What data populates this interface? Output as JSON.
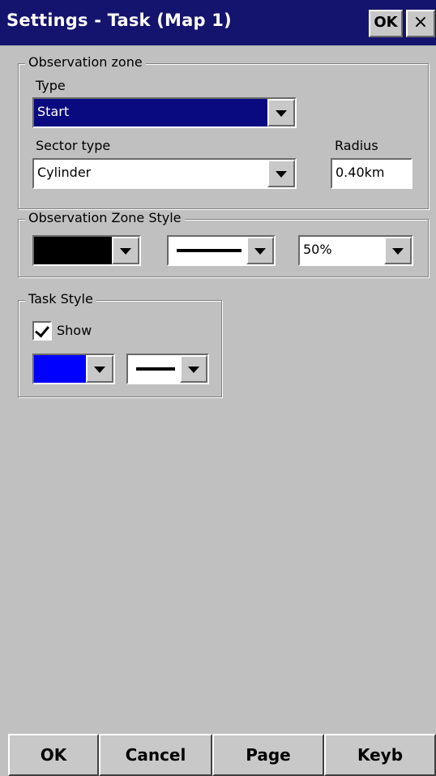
{
  "window": {
    "title": "Settings - Task (Map 1)",
    "ok_label": "OK",
    "close_label": "×",
    "title_bg_color": "#14146e"
  },
  "observation_zone": {
    "legend": "Observation zone",
    "type_label": "Type",
    "type_value": "Start",
    "sector_type_label": "Sector type",
    "sector_type_value": "Cylinder",
    "radius_label": "Radius",
    "radius_value": "0.40km"
  },
  "oz_style": {
    "legend": "Observation Zone Style",
    "color_value": "black",
    "color_hex": "#000000",
    "line_style": "solid-thick",
    "opacity_value": "50%"
  },
  "task_style": {
    "legend": "Task Style",
    "show_label": "Show",
    "show_checked": true,
    "color_value": "blue",
    "color_hex": "#0000ff",
    "line_style": "solid-thick"
  },
  "buttons": {
    "ok": "OK",
    "cancel": "Cancel",
    "page": "Page",
    "keyb": "Keyb"
  }
}
